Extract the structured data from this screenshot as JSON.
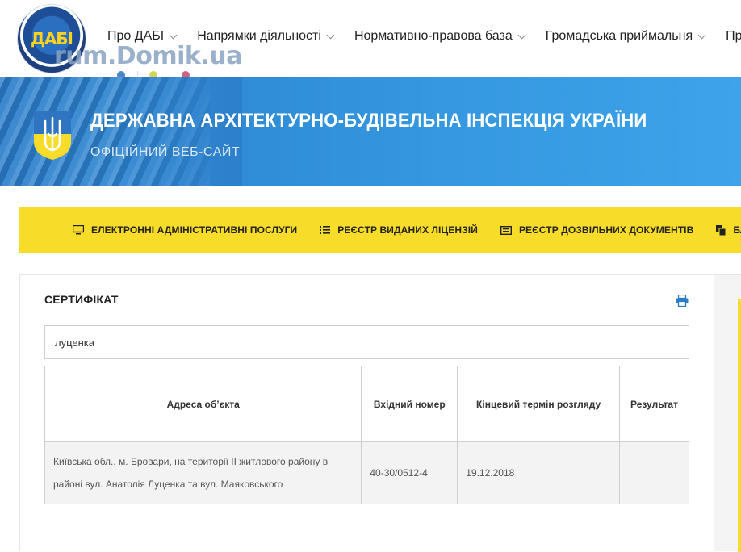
{
  "header": {
    "logo_text": "ДАБІ",
    "watermark": "rum.Domik.ua",
    "nav": [
      {
        "label": "Про ДАБІ",
        "has_dropdown": true
      },
      {
        "label": "Напрямки діяльності",
        "has_dropdown": true
      },
      {
        "label": "Нормативно-правова база",
        "has_dropdown": true
      },
      {
        "label": "Громадська приймальня",
        "has_dropdown": true
      },
      {
        "label": "Прес",
        "has_dropdown": false
      }
    ],
    "dot_colors": [
      "#4a86c8",
      "#d4d45a",
      "#d0627e"
    ]
  },
  "hero": {
    "title": "ДЕРЖАВНА АРХІТЕКТУРНО-БУДІВЕЛЬНА ІНСПЕКЦІЯ УКРАЇНИ",
    "subtitle": "ОФІЦІЙНИЙ ВЕБ-САЙТ",
    "accent_blue": "#2f8bd6"
  },
  "services_bar": {
    "color": "#f8dc2a",
    "items": [
      {
        "icon": "monitor-icon",
        "label": "ЕЛЕКТРОННІ АДМІНІСТРАТИВНІ ПОСЛУГИ"
      },
      {
        "icon": "list-icon",
        "label": "РЕЄСТР ВИДАНИХ ЛІЦЕНЗІЙ"
      },
      {
        "icon": "document-list-icon",
        "label": "РЕЄСТР ДОЗВІЛЬНИХ ДОКУМЕНТІВ"
      },
      {
        "icon": "copy-icon",
        "label": "БЛАНКИ ДОКУМЕНТІВ"
      }
    ]
  },
  "content": {
    "title": "СЕРТИФІКАТ",
    "print_icon": "print-icon",
    "search": {
      "value": "луценка",
      "placeholder": ""
    },
    "table": {
      "headers": [
        "Адреса об’єкта",
        "Вхідний номер",
        "Кінцевий термін розгляду",
        "Результат"
      ],
      "rows": [
        {
          "address": "Київська обл., м. Бровари, на території ІІ житлового району в районі вул. Анатолія Луценка та вул. Маяковського",
          "number": "40-30/0512-4",
          "deadline": "19.12.2018",
          "result": ""
        }
      ]
    }
  }
}
